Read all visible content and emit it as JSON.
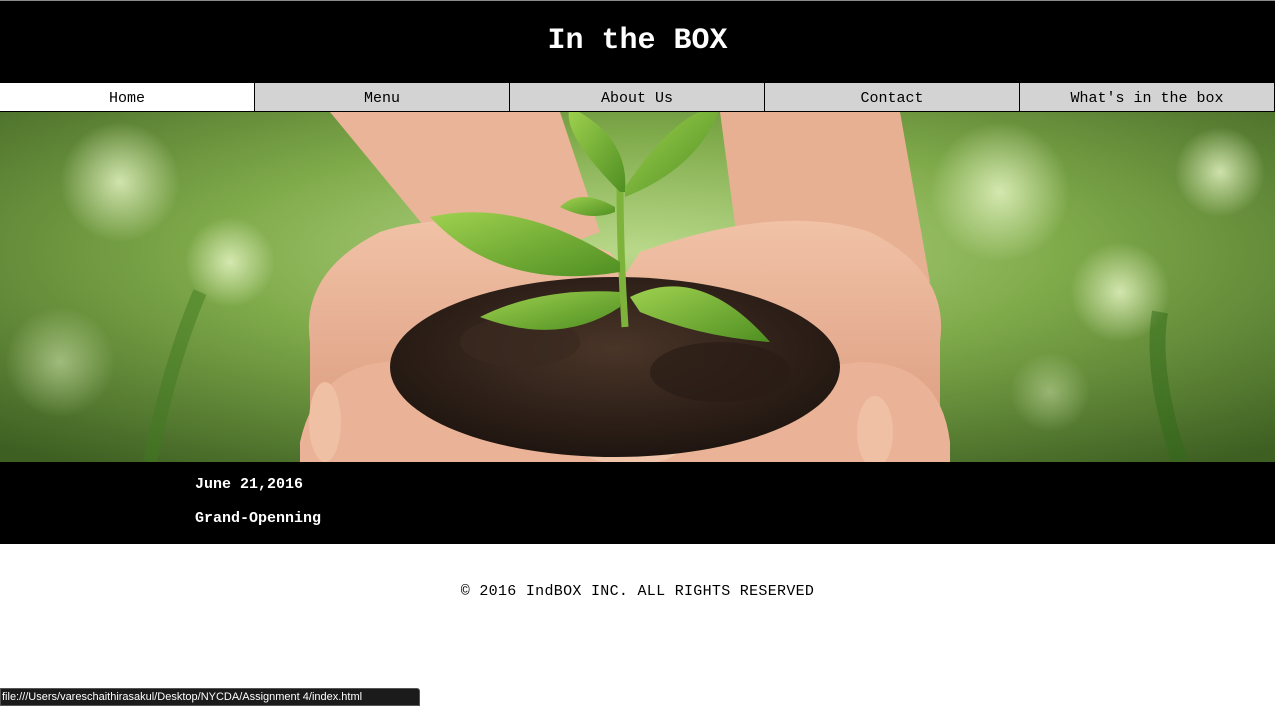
{
  "header": {
    "title": "In the BOX"
  },
  "nav": {
    "items": [
      {
        "label": "Home",
        "active": true
      },
      {
        "label": "Menu",
        "active": false
      },
      {
        "label": "About Us",
        "active": false
      },
      {
        "label": "Contact",
        "active": false
      },
      {
        "label": "What's in the box",
        "active": false
      }
    ]
  },
  "hero": {
    "subject": "hands holding soil with seedling"
  },
  "news": {
    "date": "June 21,2016",
    "title": "Grand-Openning"
  },
  "footer": {
    "copyright": "© 2016 IndBOX INC. ALL RIGHTS RESERVED"
  },
  "status_bar": {
    "url": "file:///Users/vareschaithirasakul/Desktop/NYCDA/Assignment 4/index.html"
  },
  "colors": {
    "header_bg": "#000000",
    "nav_bg": "#d3d3d3",
    "nav_active_bg": "#ffffff",
    "accent_green": "#7cb342"
  }
}
